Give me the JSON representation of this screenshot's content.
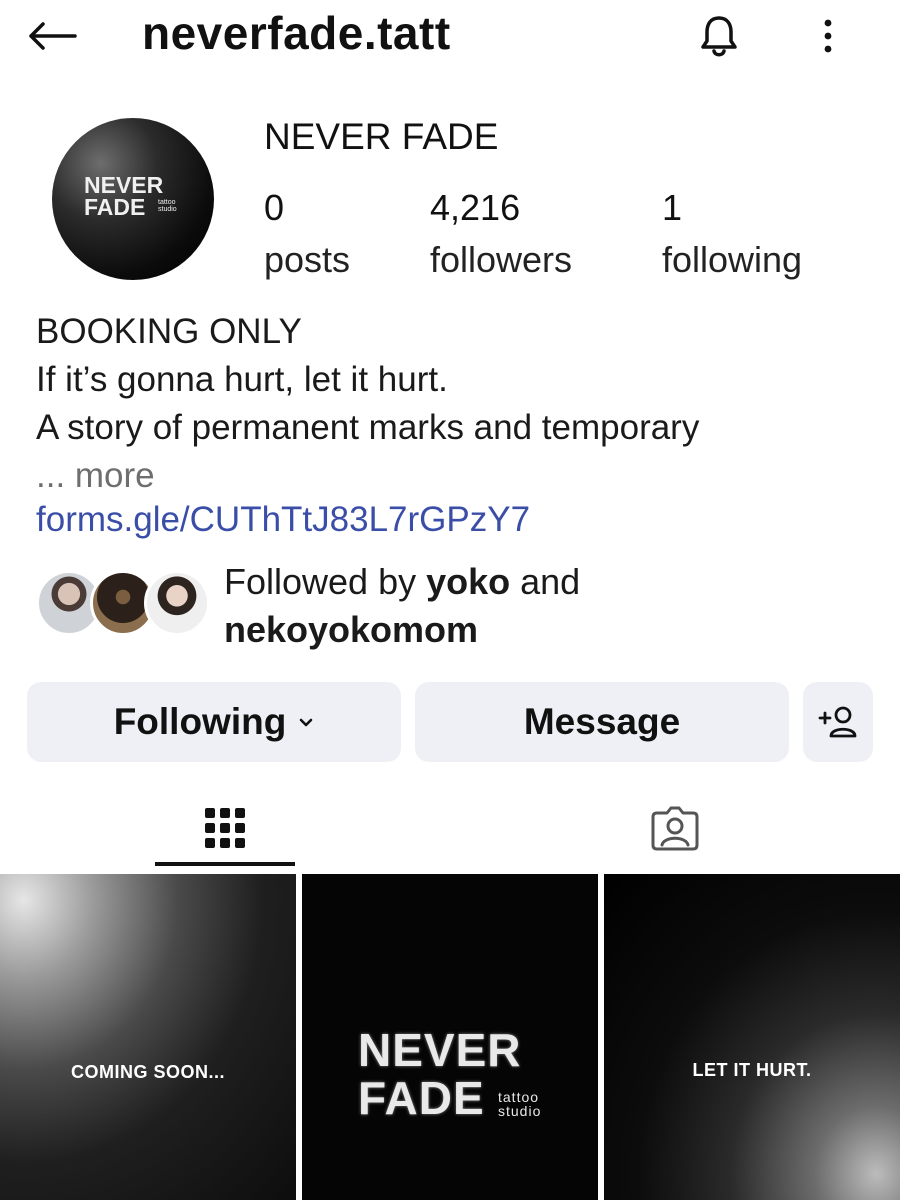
{
  "header": {
    "username": "neverfade.tatt",
    "back_icon": "arrow-left-icon",
    "bell_icon": "bell-icon",
    "more_icon": "more-vertical-icon"
  },
  "profile": {
    "avatar_logo_line1": "NEVER",
    "avatar_logo_line2": "FADE",
    "avatar_logo_sub": "tattoo studio",
    "display_name": "NEVER FADE",
    "stats": [
      {
        "value": "0",
        "label": "posts"
      },
      {
        "value": "4,216",
        "label": "followers"
      },
      {
        "value": "1",
        "label": "following"
      }
    ]
  },
  "bio": {
    "lines": [
      "BOOKING ONLY",
      "If it’s gonna hurt, let it hurt.",
      "A story of permanent marks and temporary"
    ],
    "more": "... more",
    "link": "forms.gle/CUThTtJ83L7rGPzY7"
  },
  "mutual": {
    "prefix": "Followed by ",
    "user1": "yoko",
    "conjunction": " and",
    "user2": "nekoyokomom"
  },
  "actions": {
    "following_label": "Following",
    "message_label": "Message",
    "add_user_icon": "add-user-icon"
  },
  "tabs": [
    {
      "icon": "grid-icon",
      "selected": true
    },
    {
      "icon": "tagged-person-icon",
      "selected": false
    }
  ],
  "posts": [
    {
      "caption": "COMING SOON..."
    },
    {
      "logo_line1": "NEVER",
      "logo_line2": "FADE",
      "logo_sub": "tattoo studio"
    },
    {
      "caption": "LET IT HURT."
    }
  ]
}
